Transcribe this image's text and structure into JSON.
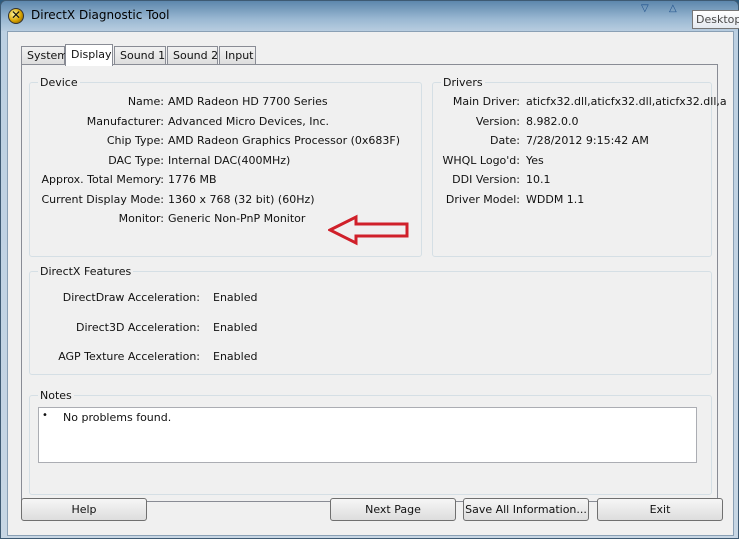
{
  "window": {
    "title": "DirectX Diagnostic Tool",
    "tooltip": "Desktop"
  },
  "tabs": [
    {
      "label": "System"
    },
    {
      "label": "Display"
    },
    {
      "label": "Sound 1"
    },
    {
      "label": "Sound 2"
    },
    {
      "label": "Input"
    }
  ],
  "device": {
    "title": "Device",
    "rows": [
      {
        "label": "Name:",
        "value": "AMD Radeon HD 7700 Series"
      },
      {
        "label": "Manufacturer:",
        "value": "Advanced Micro Devices, Inc."
      },
      {
        "label": "Chip Type:",
        "value": "AMD Radeon Graphics Processor (0x683F)"
      },
      {
        "label": "DAC Type:",
        "value": "Internal DAC(400MHz)"
      },
      {
        "label": "Approx. Total Memory:",
        "value": "1776 MB"
      },
      {
        "label": "Current Display Mode:",
        "value": "1360 x 768 (32 bit) (60Hz)"
      },
      {
        "label": "Monitor:",
        "value": "Generic Non-PnP Monitor"
      }
    ]
  },
  "drivers": {
    "title": "Drivers",
    "rows": [
      {
        "label": "Main Driver:",
        "value": "aticfx32.dll,aticfx32.dll,aticfx32.dll,a"
      },
      {
        "label": "Version:",
        "value": "8.982.0.0"
      },
      {
        "label": "Date:",
        "value": "7/28/2012 9:15:42 AM"
      },
      {
        "label": "WHQL Logo'd:",
        "value": "Yes"
      },
      {
        "label": "DDI Version:",
        "value": "10.1"
      },
      {
        "label": "Driver Model:",
        "value": "WDDM 1.1"
      }
    ]
  },
  "features": {
    "title": "DirectX Features",
    "rows": [
      {
        "label": "DirectDraw Acceleration:",
        "value": "Enabled"
      },
      {
        "label": "Direct3D Acceleration:",
        "value": "Enabled"
      },
      {
        "label": "AGP Texture Acceleration:",
        "value": "Enabled"
      }
    ]
  },
  "notes": {
    "title": "Notes",
    "items": [
      "No problems found."
    ]
  },
  "buttons": {
    "help": "Help",
    "next_page": "Next Page",
    "save_all": "Save All Information...",
    "exit": "Exit"
  },
  "colors": {
    "annotation_arrow": "#d0202a"
  }
}
